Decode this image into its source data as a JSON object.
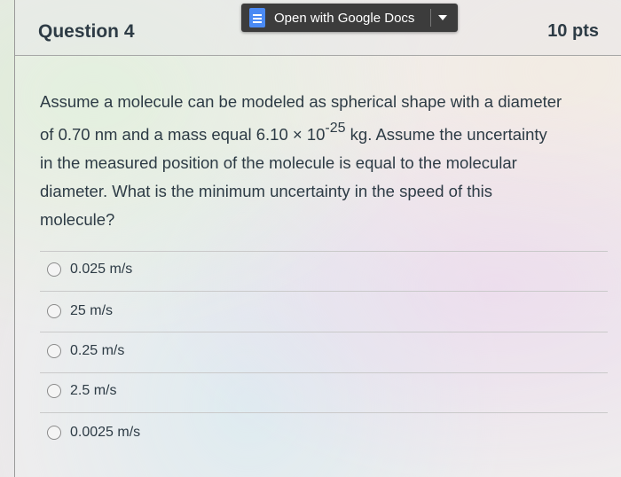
{
  "header": {
    "question_title": "Question 4",
    "points": "10 pts"
  },
  "gdocs_button": {
    "label": "Open with Google Docs",
    "icon": "google-docs-icon",
    "accent": "#4a8af4"
  },
  "question": {
    "line1": "Assume a molecule can be modeled as spherical shape with a diameter",
    "line2_pre": "of 0.70 nm and a mass equal 6.10 × 10",
    "line2_exp": "-25",
    "line2_post": " kg. Assume the uncertainty",
    "line3": "in the measured position of the molecule is equal to the molecular",
    "line4": "diameter. What is the minimum uncertainty in the speed of this",
    "line5": "molecule?"
  },
  "answers": [
    {
      "label": "0.025 m/s"
    },
    {
      "label": "25 m/s"
    },
    {
      "label": "0.25 m/s"
    },
    {
      "label": "2.5 m/s"
    },
    {
      "label": "0.0025 m/s"
    }
  ]
}
